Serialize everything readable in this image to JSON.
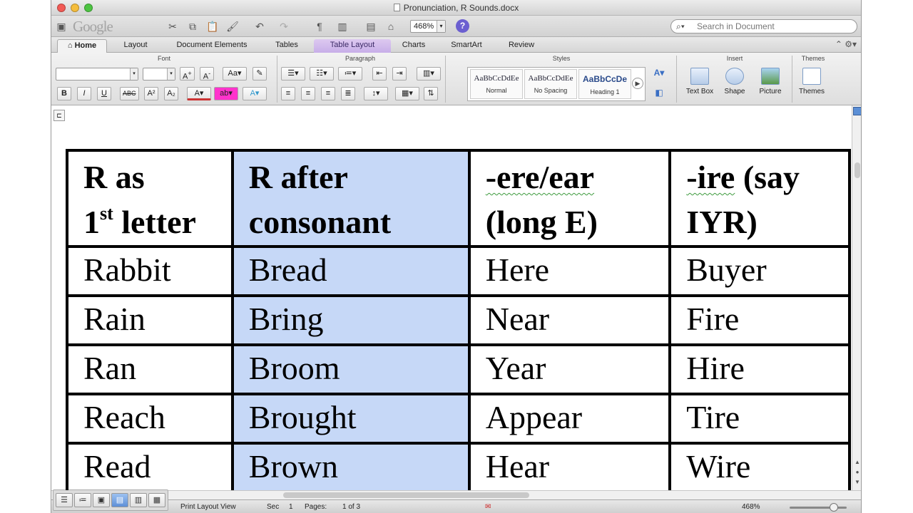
{
  "window": {
    "title": "Pronunciation, R Sounds.docx"
  },
  "toolbar": {
    "zoom": "468%",
    "search_placeholder": "Search in Document",
    "google_overlay": "Google"
  },
  "tabs": [
    {
      "label": "Home"
    },
    {
      "label": "Layout"
    },
    {
      "label": "Document Elements"
    },
    {
      "label": "Tables"
    },
    {
      "label": "Table Layout"
    },
    {
      "label": "Charts"
    },
    {
      "label": "SmartArt"
    },
    {
      "label": "Review"
    }
  ],
  "ribbon": {
    "groups": {
      "font": "Font",
      "paragraph": "Paragraph",
      "styles": "Styles",
      "insert": "Insert",
      "themes": "Themes"
    },
    "styles": [
      {
        "sample": "AaBbCcDdEe",
        "label": "Normal"
      },
      {
        "sample": "AaBbCcDdEe",
        "label": "No Spacing"
      },
      {
        "sample": "AaBbCcDe",
        "label": "Heading 1"
      }
    ],
    "insert": [
      {
        "label": "Text Box"
      },
      {
        "label": "Shape"
      },
      {
        "label": "Picture"
      }
    ],
    "themes": {
      "label": "Themes"
    }
  },
  "document": {
    "headers": [
      {
        "line1": "R as",
        "line2a": "1",
        "line2sup": "st",
        "line2b": " letter"
      },
      {
        "line1": "R after",
        "line2": "consonant"
      },
      {
        "line1a": "-ere/ear",
        "line2": "(long E)"
      },
      {
        "line1a": "-ire",
        "line1b": " (say",
        "line2": "IYR)"
      }
    ],
    "rows": [
      [
        "Rabbit",
        "Bread",
        "Here",
        "Buyer"
      ],
      [
        "Rain",
        "Bring",
        "Near",
        "Fire"
      ],
      [
        "Ran",
        "Broom",
        "Year",
        "Hire"
      ],
      [
        "Reach",
        "Brought",
        "Appear",
        "Tire"
      ],
      [
        "Read",
        "Brown",
        "Hear",
        "Wire"
      ]
    ]
  },
  "statusbar": {
    "view": "Print Layout View",
    "sec_label": "Sec",
    "sec_value": "1",
    "pages_label": "Pages:",
    "pages_value": "1 of 3",
    "zoom": "468%"
  }
}
